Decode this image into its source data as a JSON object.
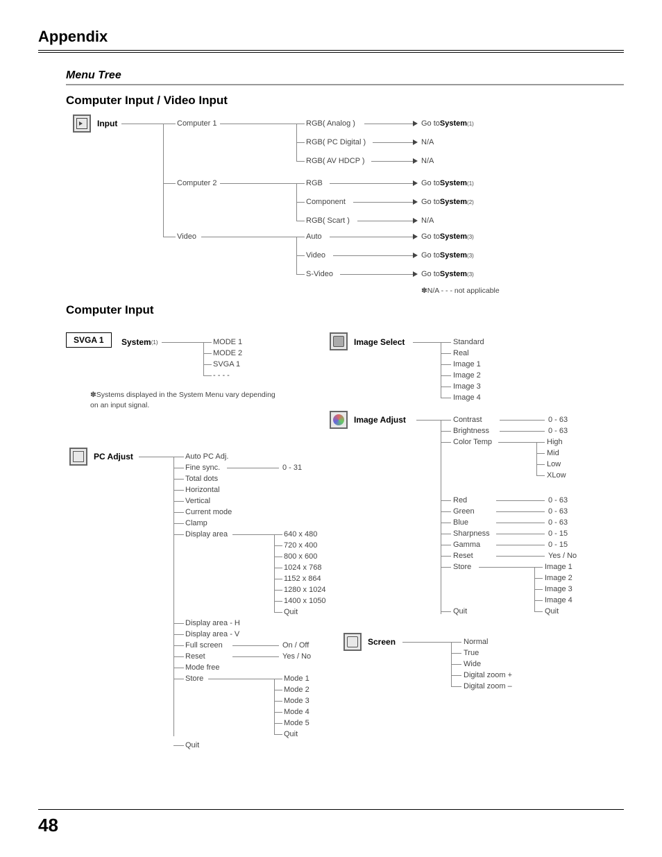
{
  "page": {
    "appendix": "Appendix",
    "menu_tree": "Menu Tree",
    "number": "48"
  },
  "section1": {
    "title": "Computer Input / Video Input",
    "root": "Input",
    "items": {
      "c1": "Computer 1",
      "c2": "Computer 2",
      "vid": "Video",
      "rgb_analog": "RGB( Analog )",
      "rgb_pcd": "RGB( PC Digital )",
      "rgb_av": "RGB( AV HDCP )",
      "rgb": "RGB",
      "component": "Component",
      "rgb_scart": "RGB( Scart )",
      "auto": "Auto",
      "video": "Video",
      "svideo": "S-Video",
      "goto": "Go to ",
      "system": "System",
      "sub1": " (1)",
      "sub2": " (2)",
      "sub3": " (3)",
      "na": "N/A"
    },
    "footnote": "✽N/A - - - not applicable"
  },
  "section2": {
    "title": "Computer Input",
    "system": {
      "label": "System",
      "sub": " (1)",
      "badge": "SVGA 1",
      "items": [
        "MODE 1",
        "MODE 2",
        "SVGA 1",
        "- - - -"
      ],
      "note": "✽Systems displayed in the System Menu vary depending on an input signal."
    },
    "pc_adjust": {
      "label": "PC Adjust",
      "items": {
        "auto": "Auto PC Adj.",
        "fine": "Fine sync.",
        "fine_range": "0 - 31",
        "total": "Total dots",
        "horiz": "Horizontal",
        "vert": "Vertical",
        "current": "Current mode",
        "clamp": "Clamp",
        "disp": "Display area",
        "disp_res": [
          "640 x 480",
          "720 x 400",
          "800 x 600",
          "1024 x 768",
          "1152 x 864",
          "1280 x 1024",
          "1400 x 1050",
          "Quit"
        ],
        "disp_h": "Display area - H",
        "disp_v": "Display area - V",
        "full": "Full screen",
        "full_val": "On / Off",
        "reset": "Reset",
        "reset_val": "Yes / No",
        "modefree": "Mode free",
        "store": "Store",
        "store_items": [
          "Mode 1",
          "Mode 2",
          "Mode 3",
          "Mode 4",
          "Mode 5",
          "Quit"
        ],
        "quit": "Quit"
      }
    },
    "image_select": {
      "label": "Image Select",
      "items": [
        "Standard",
        "Real",
        "Image 1",
        "Image 2",
        "Image 3",
        "Image 4"
      ]
    },
    "image_adjust": {
      "label": "Image Adjust",
      "items": [
        {
          "n": "Contrast",
          "v": "0 - 63"
        },
        {
          "n": "Brightness",
          "v": "0 - 63"
        },
        {
          "n": "Color Temp",
          "v": ""
        }
      ],
      "colortemp": [
        "High",
        "Mid",
        "Low",
        "XLow"
      ],
      "items2": [
        {
          "n": "Red",
          "v": "0 - 63"
        },
        {
          "n": "Green",
          "v": "0 - 63"
        },
        {
          "n": "Blue",
          "v": "0 - 63"
        },
        {
          "n": "Sharpness",
          "v": "0 - 15"
        },
        {
          "n": "Gamma",
          "v": "0 - 15"
        },
        {
          "n": "Reset",
          "v": "Yes / No"
        },
        {
          "n": "Store",
          "v": ""
        }
      ],
      "store_items": [
        "Image 1",
        "Image 2",
        "Image 3",
        "Image 4",
        "Quit"
      ],
      "quit": "Quit"
    },
    "screen": {
      "label": "Screen",
      "items": [
        "Normal",
        "True",
        "Wide",
        "Digital zoom +",
        "Digital zoom –"
      ]
    }
  }
}
